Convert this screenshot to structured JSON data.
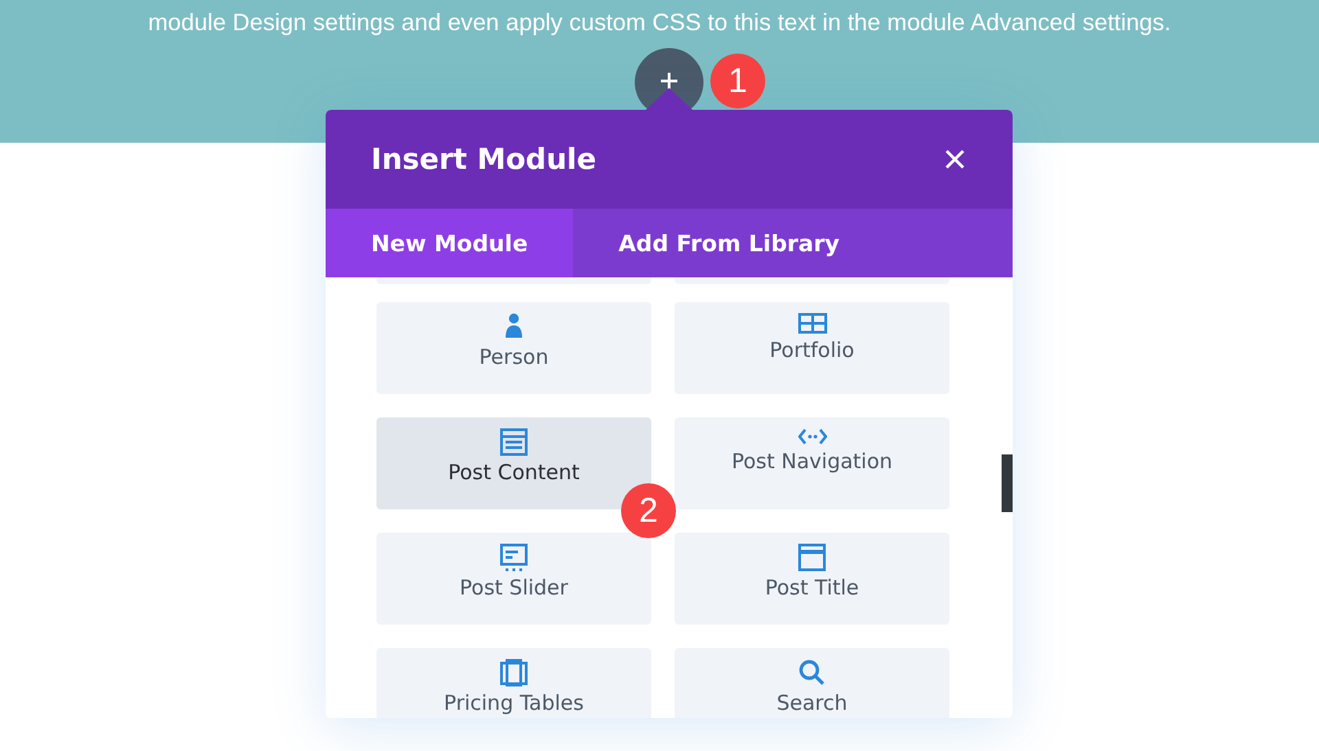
{
  "page_text": "module Design settings and even apply custom CSS to this text in the module Advanced settings.",
  "step_badges": [
    "1",
    "2"
  ],
  "modal": {
    "title": "Insert Module",
    "tabs": [
      {
        "label": "New Module",
        "selected": true
      },
      {
        "label": "Add From Library",
        "selected": false
      }
    ],
    "modules": [
      {
        "label": "Person",
        "selected": false
      },
      {
        "label": "Portfolio",
        "selected": false
      },
      {
        "label": "Post Content",
        "selected": true
      },
      {
        "label": "Post Navigation",
        "selected": false
      },
      {
        "label": "Post Slider",
        "selected": false
      },
      {
        "label": "Post Title",
        "selected": false
      },
      {
        "label": "Pricing Tables",
        "selected": false
      },
      {
        "label": "Search",
        "selected": false
      }
    ]
  }
}
